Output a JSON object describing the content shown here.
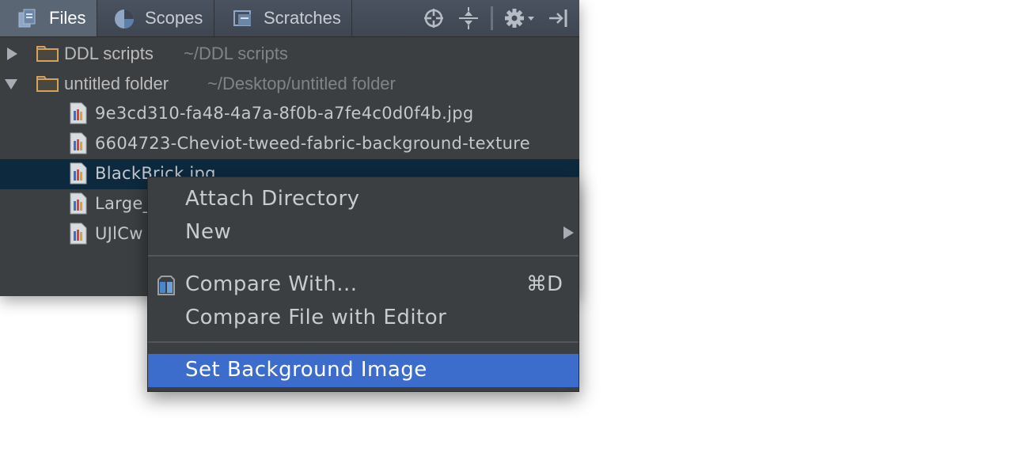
{
  "tabs": [
    {
      "label": "Files",
      "active": true,
      "icon": "files-icon"
    },
    {
      "label": "Scopes",
      "active": false,
      "icon": "scopes-icon"
    },
    {
      "label": "Scratches",
      "active": false,
      "icon": "scratches-icon"
    }
  ],
  "toolbar_icons": [
    "locate-icon",
    "collapse-all-icon",
    "gear-icon",
    "hide-icon"
  ],
  "tree": {
    "folders": [
      {
        "name": "DDL scripts",
        "path": "~/DDL scripts",
        "expanded": false
      },
      {
        "name": "untitled folder",
        "path": "~/Desktop/untitled folder",
        "expanded": true
      }
    ],
    "files": [
      {
        "name": "9e3cd310-fa48-4a7a-8f0b-a7fe4c0d0f4b.jpg"
      },
      {
        "name": "6604723-Cheviot-tweed-fabric-background-texture"
      },
      {
        "name": "BlackBrick.jpg",
        "selected": true
      },
      {
        "name": "Large_"
      },
      {
        "name": "UJlCw"
      }
    ]
  },
  "context_menu": {
    "items": [
      {
        "label": "Attach Directory"
      },
      {
        "label": "New",
        "submenu": true
      },
      {
        "label": "Compare With...",
        "shortcut": "⌘D",
        "icon": "compare-icon"
      },
      {
        "label": "Compare File with Editor"
      },
      {
        "label": "Set Background Image",
        "highlighted": true
      }
    ]
  },
  "colors": {
    "panel_bg": "#3c3f41",
    "selection_bg": "#0d293e",
    "menu_highlight": "#3d6dcc",
    "folder_color": "#d4a25a"
  }
}
